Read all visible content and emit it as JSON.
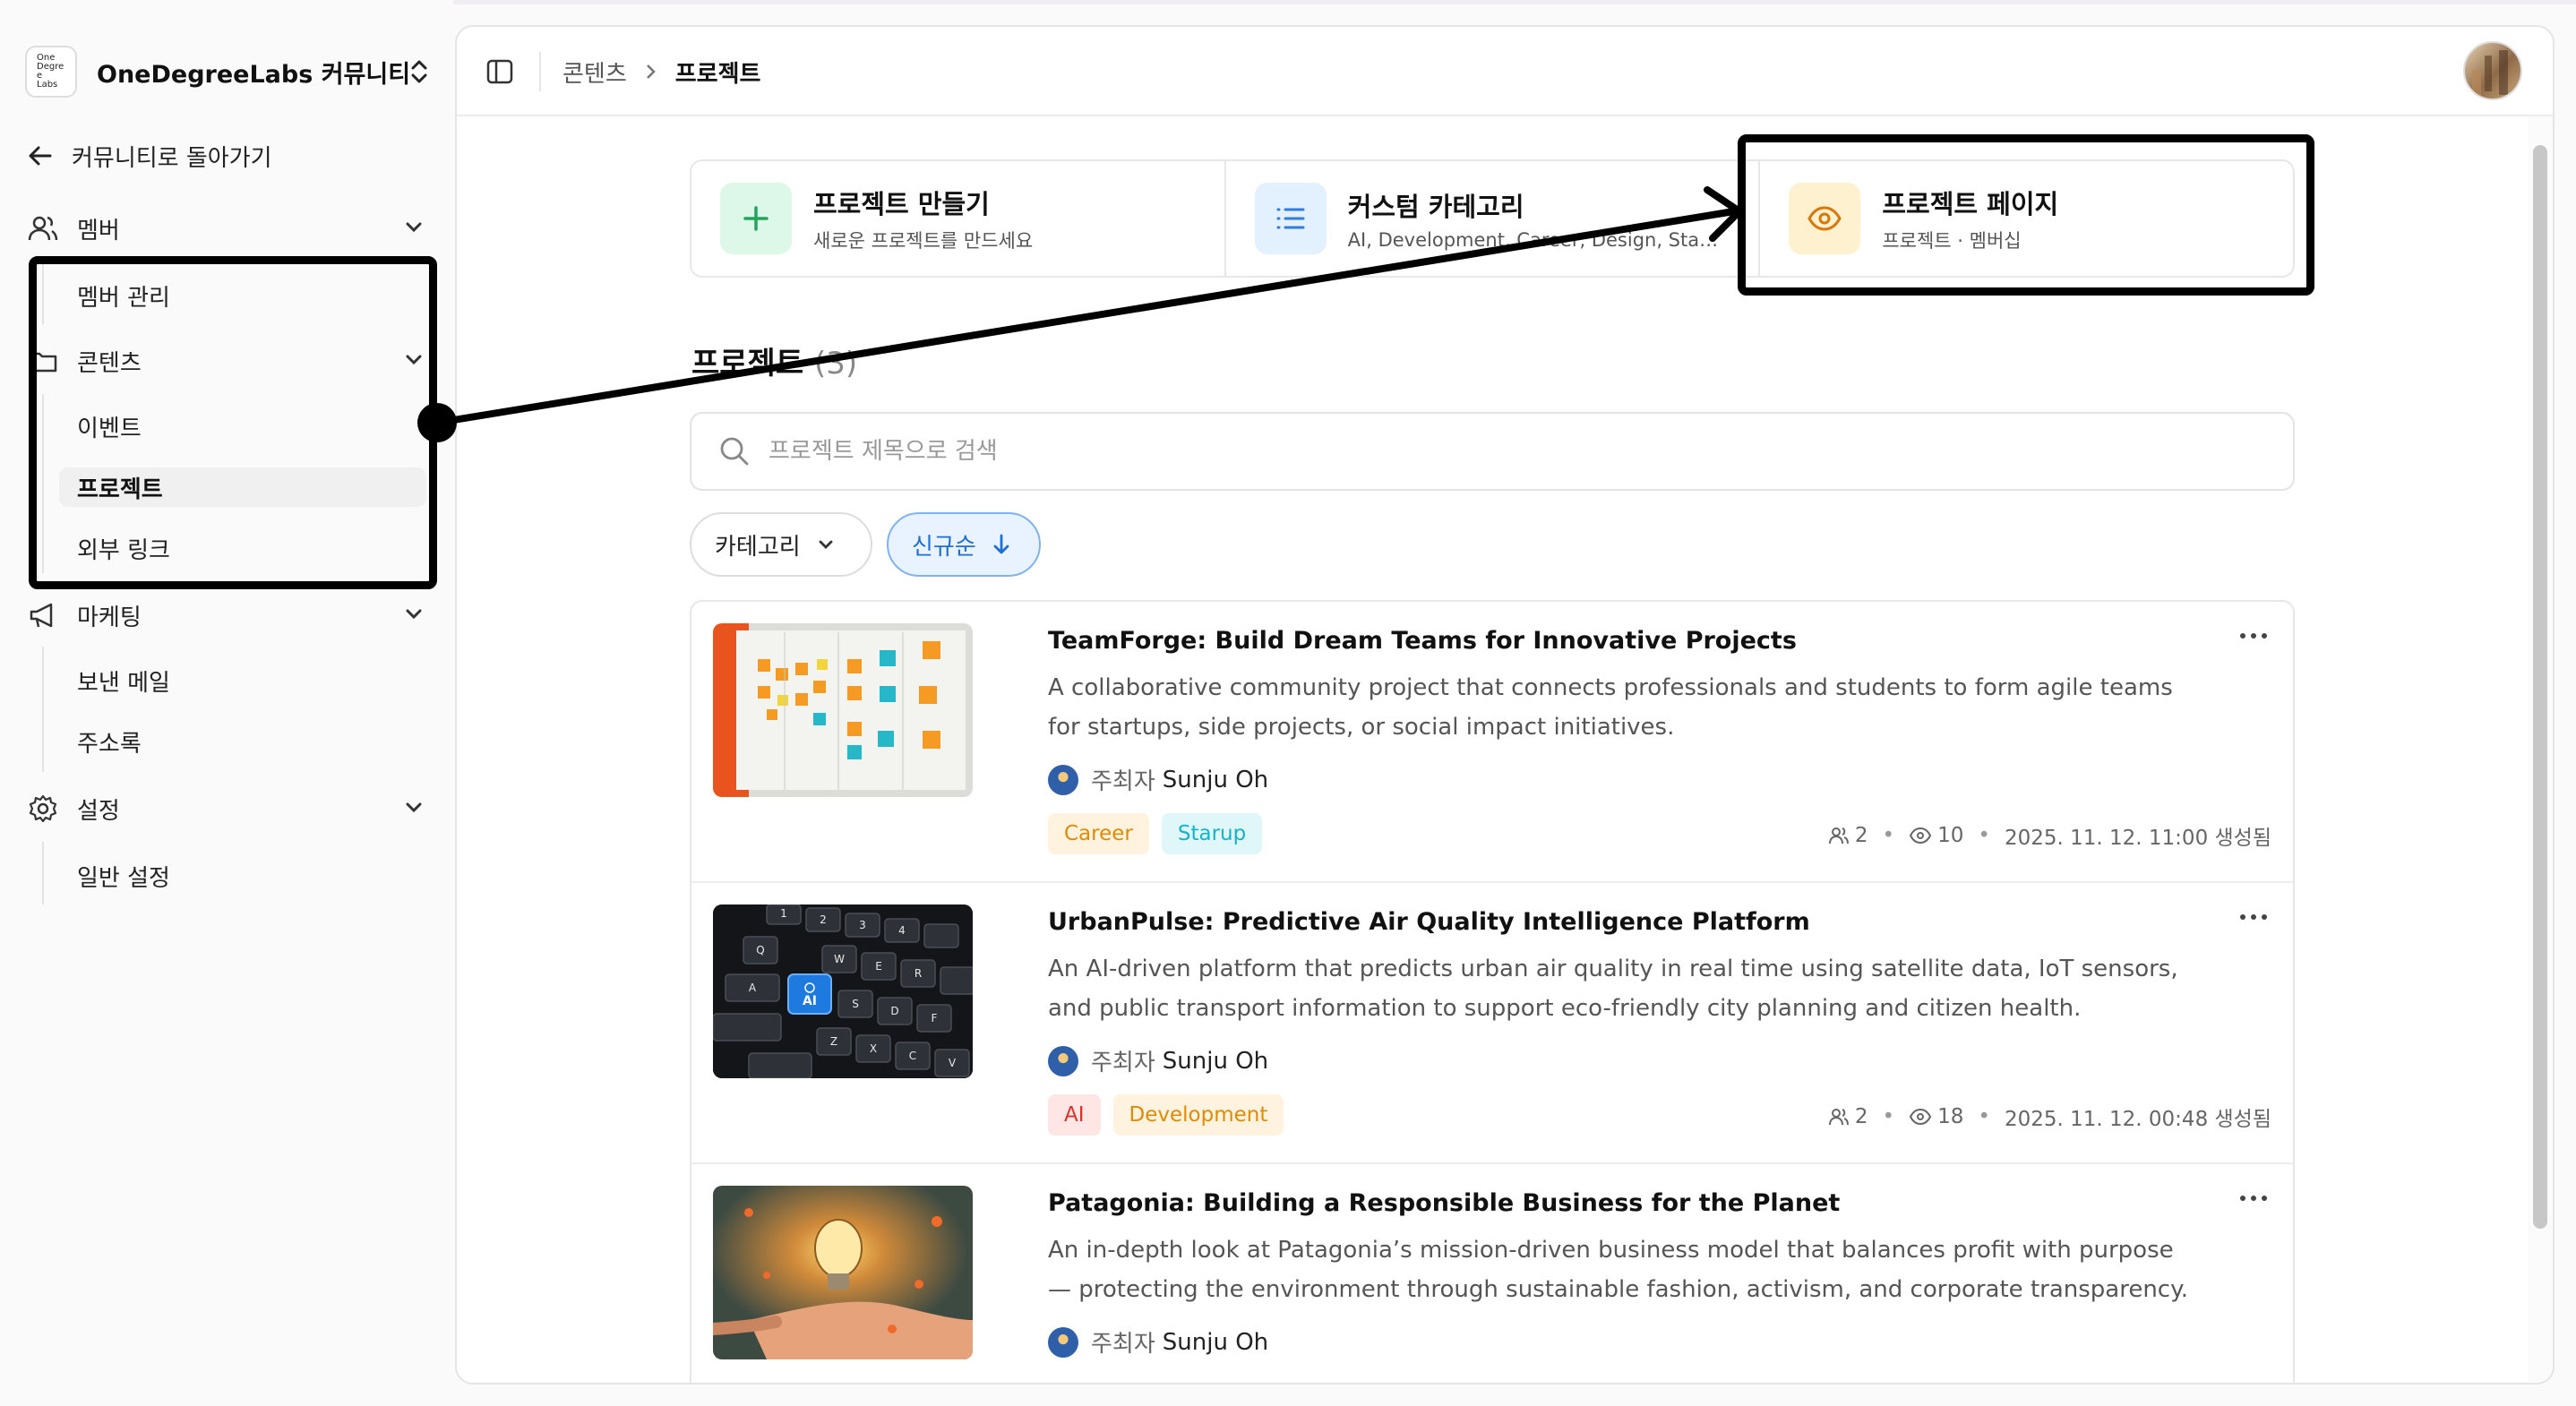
{
  "community": {
    "name": "OneDegreeLabs 커뮤니티",
    "logo_text": "One Degree Labs"
  },
  "sidebar": {
    "back_label": "커뮤니티로 돌아가기",
    "sections": [
      {
        "label": "멤버",
        "icon": "users-icon",
        "items": [
          "멤버 관리"
        ]
      },
      {
        "label": "콘텐츠",
        "icon": "folder-icon",
        "items": [
          "이벤트",
          "프로젝트",
          "외부 링크"
        ],
        "active": "프로젝트"
      },
      {
        "label": "마케팅",
        "icon": "megaphone-icon",
        "items": [
          "보낸 메일",
          "주소록"
        ]
      },
      {
        "label": "설정",
        "icon": "gear-icon",
        "items": [
          "일반 설정"
        ]
      }
    ]
  },
  "breadcrumb": [
    "콘텐츠",
    "프로젝트"
  ],
  "actions": [
    {
      "title": "프로젝트 만들기",
      "subtitle": "새로운 프로젝트를 만드세요",
      "icon": "plus-icon",
      "color": "#22a55a",
      "bg": "#ddf7e8"
    },
    {
      "title": "커스텀 카테고리",
      "subtitle": "AI, Development, Career, Design, Startup",
      "icon": "list-icon",
      "color": "#2f7de1",
      "bg": "#e3f0fd"
    },
    {
      "title": "프로젝트 페이지",
      "subtitle": "프로젝트 · 멤버십",
      "icon": "eye-icon",
      "color": "#d97706",
      "bg": "#fdf1cf"
    }
  ],
  "section": {
    "title": "프로젝트",
    "count": "(3)"
  },
  "search": {
    "placeholder": "프로젝트 제목으로 검색"
  },
  "filters": {
    "category": "카테고리",
    "sort": "신규순"
  },
  "projects": [
    {
      "title": "TeamForge: Build Dream Teams for Innovative Projects",
      "description": "A collaborative community project that connects professionals and students to form agile teams for startups, side projects, or social impact initiatives.",
      "host_label": "주최자",
      "host": "Sunju Oh",
      "tags": [
        {
          "label": "Career",
          "color": "#e08a00",
          "bg": "#fff3df"
        },
        {
          "label": "Starup",
          "color": "#13b3c9",
          "bg": "#e0f7fa"
        }
      ],
      "members": "2",
      "views": "10",
      "created": "2025. 11. 12. 11:00 생성됨"
    },
    {
      "title": "UrbanPulse: Predictive Air Quality Intelligence Platform",
      "description": "An AI-driven platform that predicts urban air quality in real time using satellite data, IoT sensors, and public transport information to support eco-friendly city planning and citizen health.",
      "host_label": "주최자",
      "host": "Sunju Oh",
      "tags": [
        {
          "label": "AI",
          "color": "#d9342b",
          "bg": "#fde6e4"
        },
        {
          "label": "Development",
          "color": "#e08a00",
          "bg": "#fff3df"
        }
      ],
      "members": "2",
      "views": "18",
      "created": "2025. 11. 12. 00:48 생성됨"
    },
    {
      "title": "Patagonia: Building a Responsible Business for the Planet",
      "description": "An in-depth look at Patagonia’s mission-driven business model that balances profit with purpose — protecting the environment through sustainable fashion, activism, and corporate transparency.",
      "host_label": "주최자",
      "host": "Sunju Oh",
      "tags": [],
      "members": "",
      "views": "",
      "created": ""
    }
  ],
  "keyboard_keys": [
    "1",
    "2",
    "3",
    "4",
    "Q",
    "W",
    "E",
    "R",
    "A",
    "S",
    "D",
    "F",
    "Z",
    "X",
    "C",
    "V",
    "AI"
  ]
}
